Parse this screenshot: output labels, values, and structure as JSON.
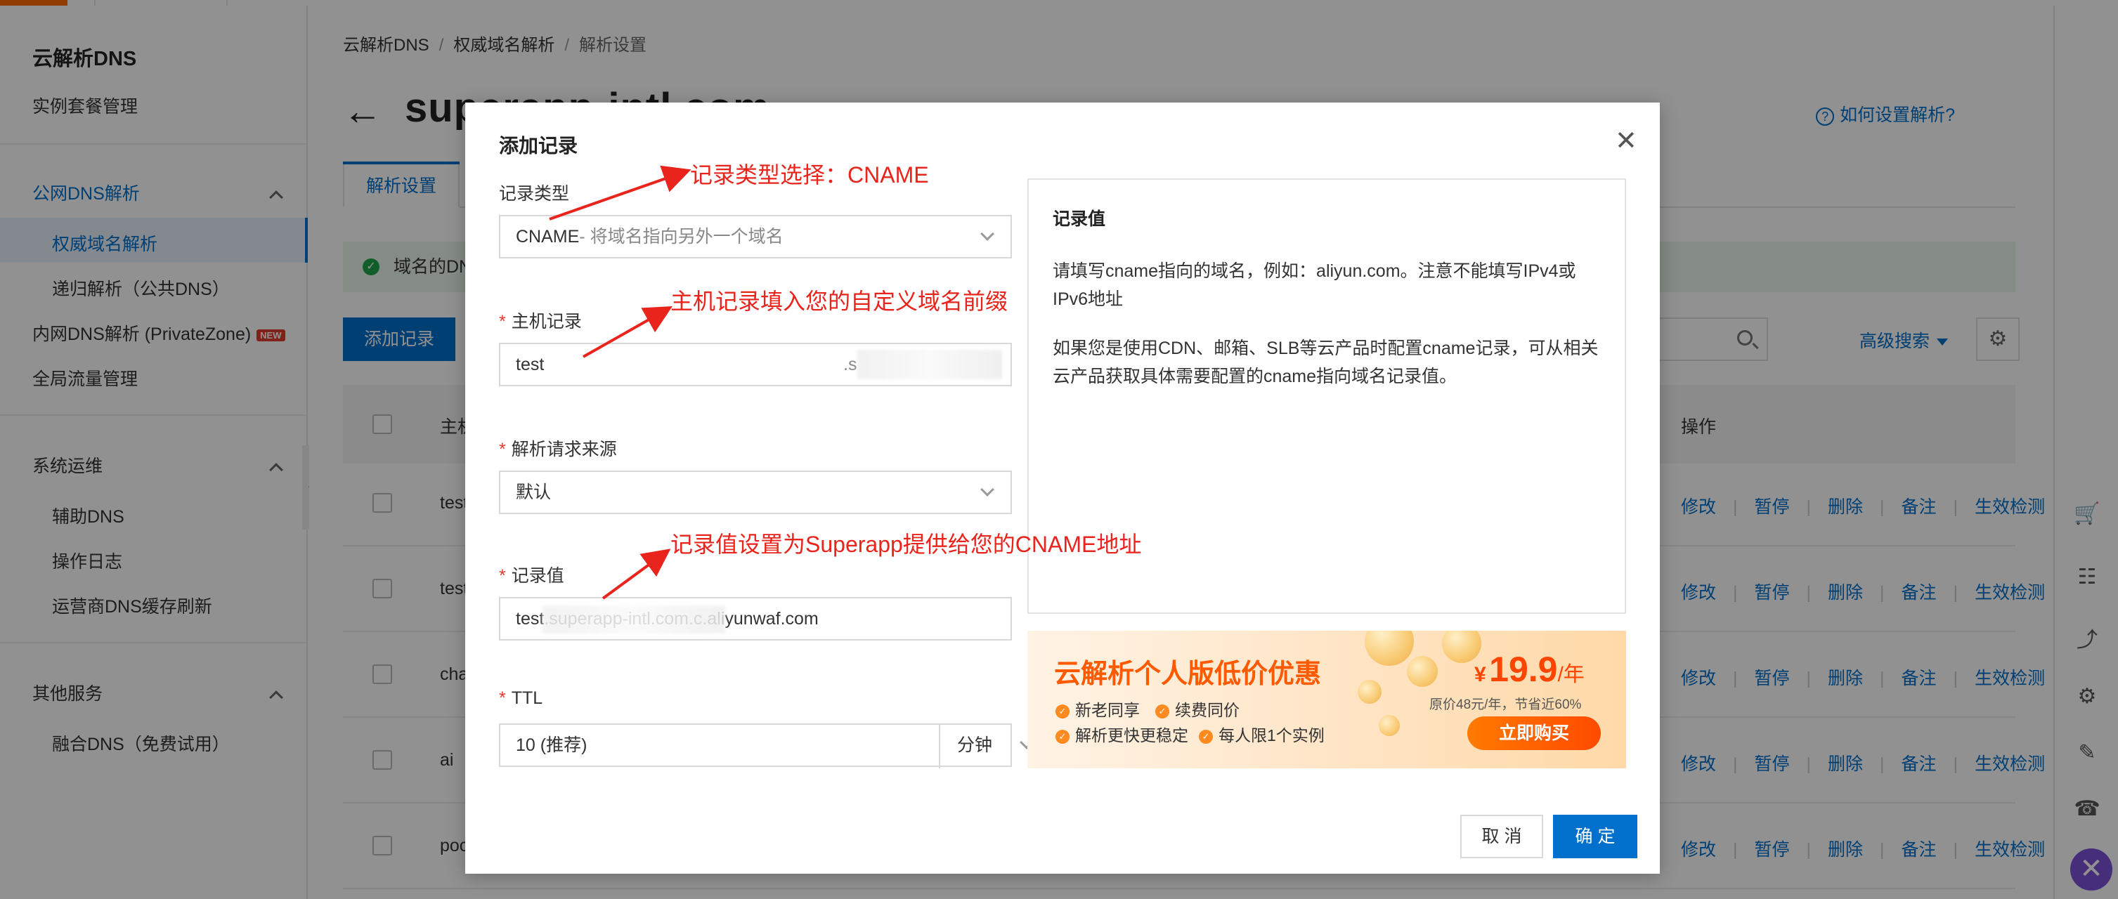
{
  "sidebar": {
    "title": "云解析DNS",
    "instance_mgmt": "实例套餐管理",
    "group_public": "公网DNS解析",
    "authoritative": "权威域名解析",
    "recursive": "递归解析（公共DNS）",
    "private_zone": "内网DNS解析 (PrivateZone)",
    "new_badge": "NEW",
    "global_traffic": "全局流量管理",
    "group_ops": "系统运维",
    "aux_dns": "辅助DNS",
    "op_log": "操作日志",
    "isp_cache": "运营商DNS缓存刷新",
    "group_other": "其他服务",
    "fusion_dns": "融合DNS（免费试用）"
  },
  "breadcrumb": {
    "items": [
      "云解析DNS",
      "权威域名解析",
      "解析设置"
    ],
    "separator": "/"
  },
  "header": {
    "domain": "superapp-intl.com",
    "help_link": "如何设置解析?"
  },
  "tabs": {
    "active": "解析设置"
  },
  "notice": {
    "text": "域名的DNS"
  },
  "toolbar": {
    "add_record": "添加记录",
    "advanced_search": "高级搜索"
  },
  "table": {
    "col_host": "主机",
    "col_ops": "操作",
    "rows": [
      {
        "host": "test"
      },
      {
        "host": "test"
      },
      {
        "host": "cha"
      },
      {
        "host": "ai"
      },
      {
        "host": "poc"
      }
    ],
    "ops": {
      "edit": "修改",
      "pause": "暂停",
      "delete": "删除",
      "note": "备注",
      "check": "生效检测"
    }
  },
  "modal": {
    "title": "添加记录",
    "record_type": {
      "label": "记录类型",
      "value": "CNAME",
      "hint": "- 将域名指向另外一个域名"
    },
    "host": {
      "label": "主机记录",
      "value": "test",
      "suffix": ".s"
    },
    "source": {
      "label": "解析请求来源",
      "value": "默认"
    },
    "record_value": {
      "label": "记录值",
      "value": "test.superapp-intl.com.c.aliyunwaf.com"
    },
    "ttl": {
      "label": "TTL",
      "value": "10 (推荐)",
      "unit": "分钟"
    },
    "help_panel": {
      "title": "记录值",
      "para1": "请填写cname指向的域名，例如：aliyun.com。注意不能填写IPv4或IPv6地址",
      "para2": "如果您是使用CDN、邮箱、SLB等云产品时配置cname记录，可从相关云产品获取具体需要配置的cname指向域名记录值。"
    },
    "promo": {
      "title": "云解析个人版低价优惠",
      "features": [
        "新老同享",
        "续费同价",
        "解析更快更稳定",
        "每人限1个实例"
      ],
      "currency": "¥",
      "price": "19.9",
      "per": "/年",
      "original": "原价48元/年，节省近60%",
      "buy": "立即购买"
    },
    "cancel": "取 消",
    "ok": "确 定"
  },
  "annotations": {
    "a1": "记录类型选择：CNAME",
    "a2": "主机记录填入您的自定义域名前缀",
    "a3": "记录值设置为Superapp提供给您的CNAME地址"
  },
  "colors": {
    "accent": "#0070cc",
    "annotation": "#e8241c",
    "promo": "#ff5a00",
    "required": "#e23c2f"
  }
}
